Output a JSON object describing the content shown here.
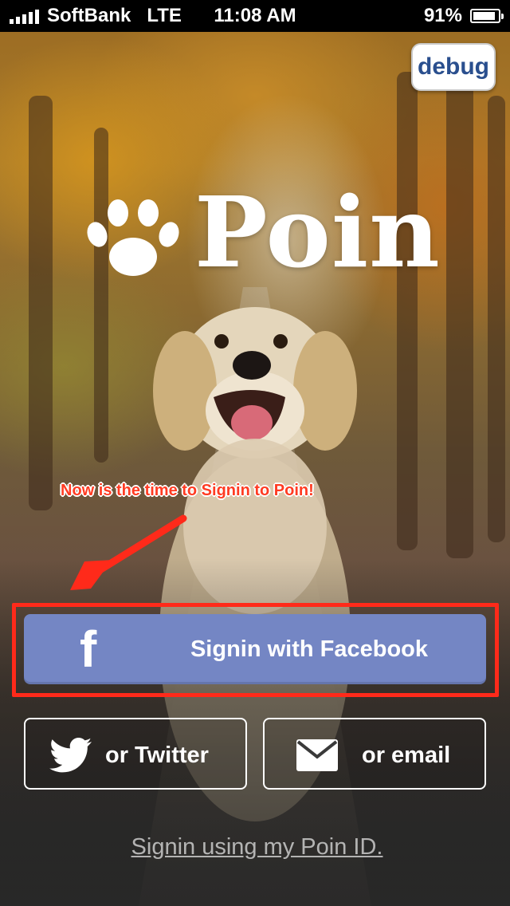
{
  "status_bar": {
    "carrier": "SoftBank",
    "network": "LTE",
    "time": "11:08 AM",
    "battery_percent": "91%",
    "battery_level": 0.91,
    "signal_bars": 5
  },
  "debug_button": {
    "label": "debug"
  },
  "logo": {
    "text": "Poin",
    "icon": "paw-icon"
  },
  "annotation": {
    "text": "Now is the time to Signin to Poin!",
    "color": "#ff3b22"
  },
  "buttons": {
    "facebook": {
      "label": "Signin with Facebook",
      "icon": "facebook-icon",
      "color": "#7486c4"
    },
    "twitter": {
      "label": "or Twitter",
      "icon": "twitter-bird-icon"
    },
    "email": {
      "label": "or email",
      "icon": "envelope-icon"
    }
  },
  "poin_id_link": {
    "label": "Signin using my Poin ID."
  }
}
